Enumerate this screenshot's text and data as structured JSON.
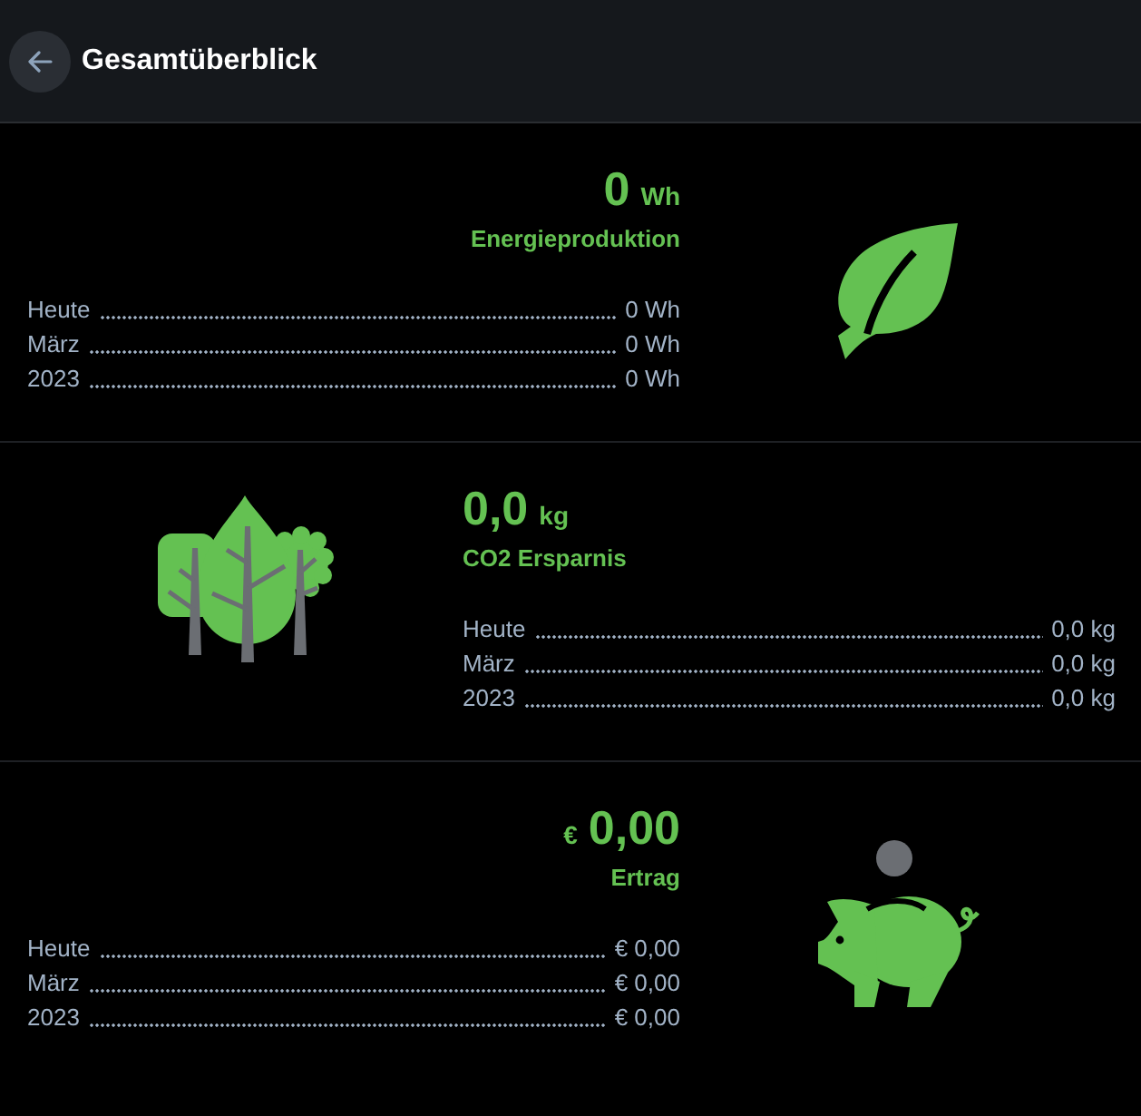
{
  "header": {
    "title": "Gesamtüberblick"
  },
  "sections": [
    {
      "kind": "energy",
      "headline": [
        {
          "kind": "number",
          "text": "0"
        },
        {
          "kind": "unit",
          "text": "Wh"
        }
      ],
      "label": "Energieproduktion",
      "rows": [
        {
          "period": "Heute",
          "value": "0 Wh"
        },
        {
          "period": "März",
          "value": "0 Wh"
        },
        {
          "period": "2023",
          "value": "0 Wh"
        }
      ]
    },
    {
      "kind": "co2",
      "headline": [
        {
          "kind": "number",
          "text": "0,0"
        },
        {
          "kind": "unit",
          "text": "kg"
        }
      ],
      "label": "CO2 Ersparnis",
      "rows": [
        {
          "period": "Heute",
          "value": "0,0 kg"
        },
        {
          "period": "März",
          "value": "0,0 kg"
        },
        {
          "period": "2023",
          "value": "0,0 kg"
        }
      ]
    },
    {
      "kind": "revenue",
      "headline": [
        {
          "kind": "unit",
          "text": "€"
        },
        {
          "kind": "number",
          "text": "0,00"
        }
      ],
      "label": "Ertrag",
      "rows": [
        {
          "period": "Heute",
          "value": "€ 0,00"
        },
        {
          "period": "März",
          "value": "€ 0,00"
        },
        {
          "period": "2023",
          "value": "€ 0,00"
        }
      ]
    }
  ]
}
